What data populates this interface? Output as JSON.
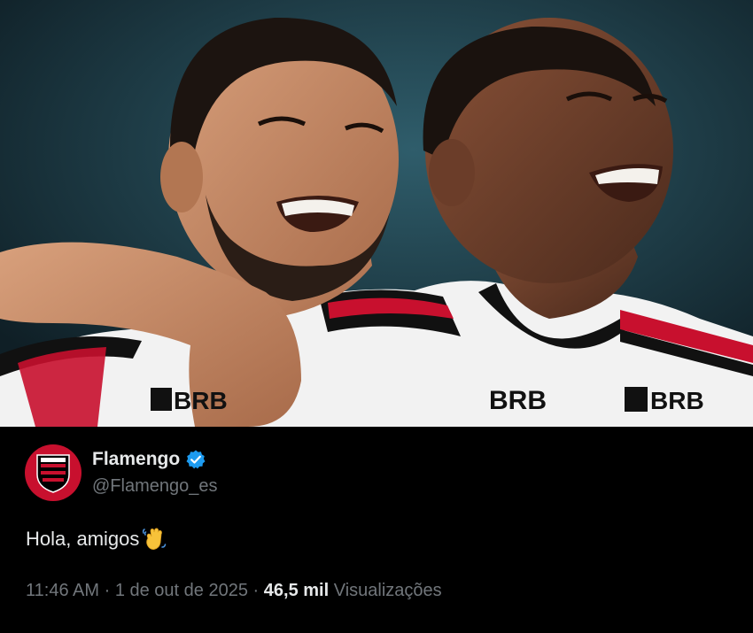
{
  "tweet": {
    "display_name": "Flamengo",
    "handle": "@Flamengo_es",
    "verified": true,
    "text": "Hola, amigos",
    "emoji": "waving-hand-icon",
    "time": "11:46 AM",
    "separator": "·",
    "date": "1 de out de 2025",
    "views_count": "46,5 mil",
    "views_label": "Visualizações"
  },
  "photo": {
    "sponsor_left": "BRB",
    "sponsor_center": "BRB",
    "sponsor_right": "BRB"
  },
  "colors": {
    "background": "#000000",
    "text_primary": "#e7e9ea",
    "text_secondary": "#71767b",
    "verified_blue": "#1d9bf0",
    "flamengo_red": "#c8102e"
  }
}
